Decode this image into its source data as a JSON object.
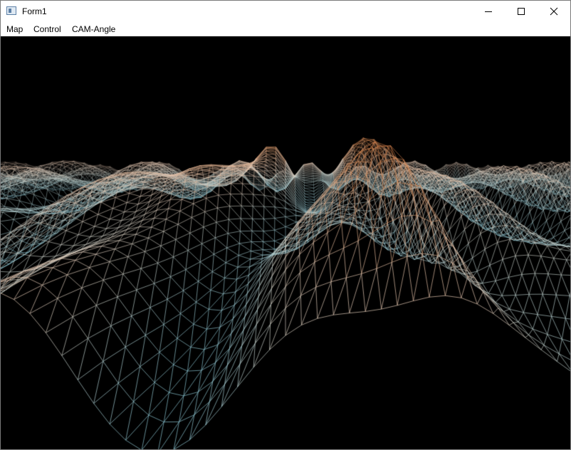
{
  "window": {
    "title": "Form1",
    "controls": {
      "minimize_icon": "minimize-icon",
      "maximize_icon": "maximize-icon",
      "close_icon": "close-icon"
    }
  },
  "menubar": {
    "items": [
      {
        "label": "Map"
      },
      {
        "label": "Control"
      },
      {
        "label": "CAM-Angle"
      }
    ]
  },
  "scene": {
    "background": "#000000",
    "mesh_palette": {
      "valley": "#7cc6d9",
      "low": "#b0cfd2",
      "mid": "#e7cbb6",
      "high": "#d48a56",
      "peak": "#c8642e"
    }
  }
}
